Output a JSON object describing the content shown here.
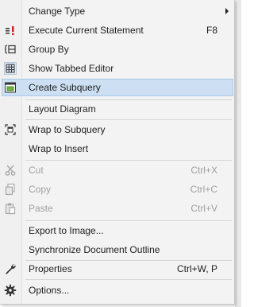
{
  "menu": {
    "items": [
      {
        "label": "Change Type",
        "shortcut": "",
        "icon": "none",
        "submenu": true
      },
      {
        "label": "Execute Current Statement",
        "shortcut": "F8",
        "icon": "execute-statement-icon"
      },
      {
        "label": "Group By",
        "shortcut": "",
        "icon": "group-by-icon"
      },
      {
        "label": "Show Tabbed Editor",
        "shortcut": "",
        "icon": "grid-icon"
      },
      {
        "label": "Create Subquery",
        "shortcut": "",
        "icon": "create-subquery-icon",
        "highlighted": true
      },
      {
        "label": "Layout Diagram",
        "shortcut": "",
        "icon": "none"
      },
      {
        "label": "Wrap to Subquery",
        "shortcut": "",
        "icon": "wrap-subquery-icon"
      },
      {
        "label": "Wrap to Insert",
        "shortcut": "",
        "icon": "none"
      },
      {
        "label": "Cut",
        "shortcut": "Ctrl+X",
        "icon": "scissors-icon",
        "disabled": true
      },
      {
        "label": "Copy",
        "shortcut": "Ctrl+C",
        "icon": "copy-icon",
        "disabled": true
      },
      {
        "label": "Paste",
        "shortcut": "Ctrl+V",
        "icon": "paste-icon",
        "disabled": true
      },
      {
        "label": "Export to Image...",
        "shortcut": "",
        "icon": "none"
      },
      {
        "label": "Synchronize Document Outline",
        "shortcut": "",
        "icon": "none"
      },
      {
        "label": "Properties",
        "shortcut": "Ctrl+W, P",
        "icon": "wrench-icon"
      },
      {
        "label": "Options...",
        "shortcut": "",
        "icon": "gear-icon"
      }
    ]
  },
  "colors": {
    "highlight": "#cde0f3",
    "highlight_border": "#a8c8ec",
    "disabled_text": "#a0a0a0",
    "execute_red": "#d02020"
  }
}
